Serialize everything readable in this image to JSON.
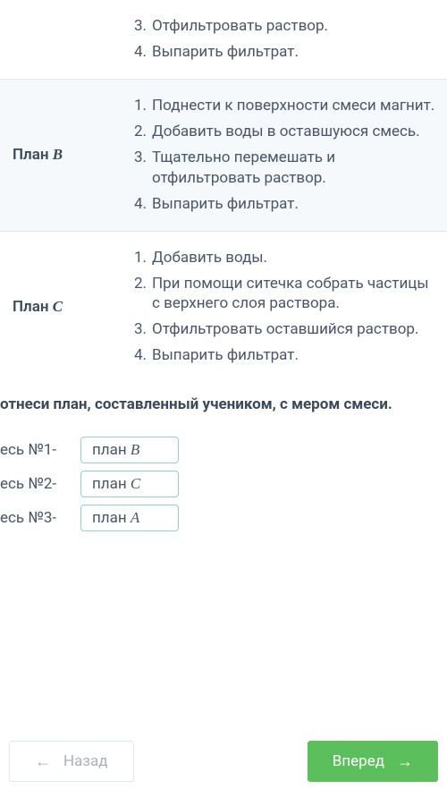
{
  "plans": [
    {
      "label_prefix": "",
      "label_letter": "",
      "steps_start_index": 3,
      "steps": [
        "Отфильтровать раствор.",
        "Выпарить фильтрат."
      ]
    },
    {
      "label_prefix": "План ",
      "label_letter": "B",
      "steps_start_index": 1,
      "steps": [
        "Поднести к поверхности смеси магнит.",
        "Добавить воды в оставшуюся смесь.",
        "Тщательно перемешать и отфильтровать раствор.",
        "Выпарить фильтрат."
      ]
    },
    {
      "label_prefix": "План ",
      "label_letter": "C",
      "steps_start_index": 1,
      "steps": [
        "Добавить воды.",
        "При помощи ситечка собрать частицы с верхнего слоя раствора.",
        "Отфильтровать оставшийся раствор.",
        "Выпарить фильтрат."
      ]
    }
  ],
  "instruction": "отнеси план, составленный учеником, с мером смеси.",
  "answers": [
    {
      "mix_label": "есь №1-",
      "plan_prefix": "план ",
      "plan_letter": "B"
    },
    {
      "mix_label": "есь №2-",
      "plan_prefix": "план ",
      "plan_letter": "C"
    },
    {
      "mix_label": "есь №3-",
      "plan_prefix": "план ",
      "plan_letter": "A"
    }
  ],
  "nav": {
    "back": "Назад",
    "next": "Вперед"
  }
}
